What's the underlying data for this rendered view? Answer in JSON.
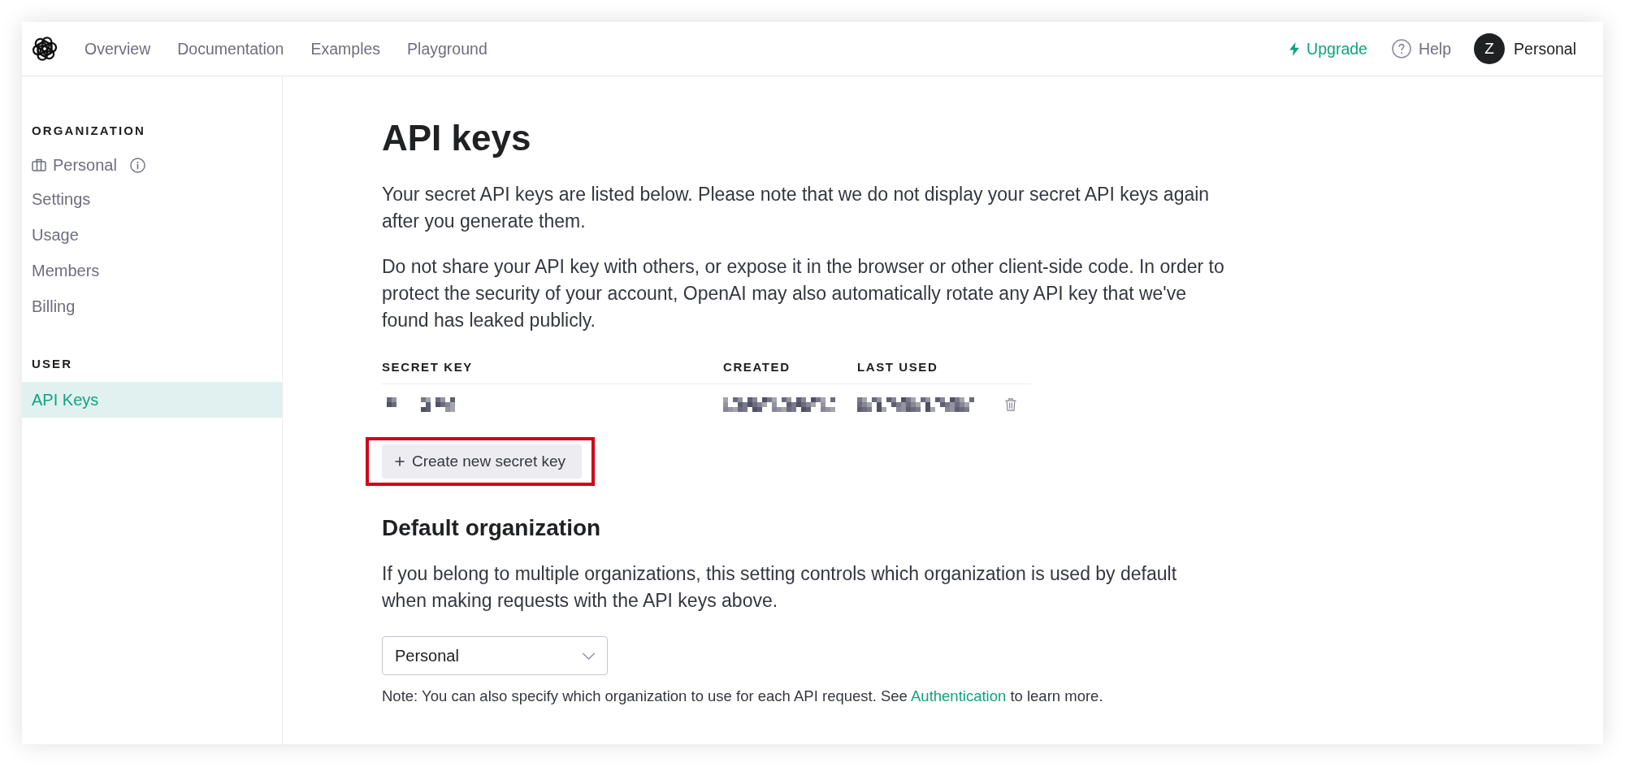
{
  "nav": {
    "links": [
      {
        "label": "Overview",
        "selected": false
      },
      {
        "label": "Documentation",
        "selected": false
      },
      {
        "label": "Examples",
        "selected": false
      },
      {
        "label": "Playground",
        "selected": false
      }
    ],
    "upgrade": "Upgrade",
    "help": "Help",
    "account": {
      "initial": "Z",
      "name": "Personal"
    }
  },
  "sidebar": {
    "sections": [
      {
        "heading": "ORGANIZATION",
        "items": [
          {
            "kind": "org",
            "label": "Personal",
            "selected": false
          },
          {
            "kind": "link",
            "label": "Settings",
            "selected": false
          },
          {
            "kind": "link",
            "label": "Usage",
            "selected": false
          },
          {
            "kind": "link",
            "label": "Members",
            "selected": false
          },
          {
            "kind": "link",
            "label": "Billing",
            "selected": false
          }
        ]
      },
      {
        "heading": "USER",
        "items": [
          {
            "kind": "link",
            "label": "API Keys",
            "selected": true
          }
        ]
      }
    ]
  },
  "page": {
    "title": "API keys",
    "intro": [
      "Your secret API keys are listed below. Please note that we do not display your secret API keys again after you generate them.",
      "Do not share your API key with others, or expose it in the browser or other client-side code. In order to protect the security of your account, OpenAI may also automatically rotate any API key that we've found has leaked publicly."
    ],
    "keys_table": {
      "columns": [
        "SECRET KEY",
        "CREATED",
        "LAST USED"
      ],
      "rows": [
        {
          "cells": [
            {
              "kind": "redacted"
            },
            {
              "kind": "redacted"
            },
            {
              "kind": "redacted"
            }
          ],
          "deletable": true
        }
      ]
    },
    "create_button": {
      "label": "Create new secret key",
      "highlighted": true
    },
    "default_org": {
      "heading": "Default organization",
      "text": "If you belong to multiple organizations, this setting controls which organization is used by default when making requests with the API keys above.",
      "select": {
        "value": "Personal"
      },
      "note": {
        "before": "Note: You can also specify which organization to use for each API request. See",
        "link": "Authentication",
        "after": "to learn more."
      }
    }
  }
}
